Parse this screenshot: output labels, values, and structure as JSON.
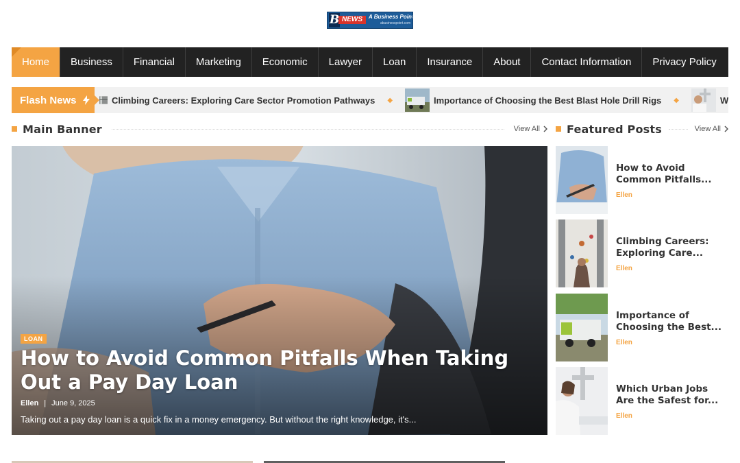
{
  "logo": {
    "letter": "B",
    "badge": "NEWS",
    "tagline": "A Business Point",
    "url": "abusinesspoint.com"
  },
  "nav": {
    "items": [
      {
        "label": "Home",
        "active": true
      },
      {
        "label": "Business"
      },
      {
        "label": "Financial"
      },
      {
        "label": "Marketing"
      },
      {
        "label": "Economic"
      },
      {
        "label": "Lawyer"
      },
      {
        "label": "Loan"
      },
      {
        "label": "Insurance"
      },
      {
        "label": "About"
      },
      {
        "label": "Contact Information"
      },
      {
        "label": "Privacy Policy"
      }
    ]
  },
  "flash": {
    "label": "Flash News",
    "icon": "lightning-icon",
    "items": [
      {
        "title": "Climbing Careers: Exploring Care Sector Promotion Pathways"
      },
      {
        "title": "Importance of Choosing the Best Blast Hole Drill Rigs"
      },
      {
        "title": "Which U"
      }
    ]
  },
  "main_banner": {
    "heading": "Main Banner",
    "view_all": "View All",
    "post": {
      "category": "LOAN",
      "title": "How to Avoid Common Pitfalls When Taking Out a Pay Day Loan",
      "author": "Ellen",
      "separator": "|",
      "date": "June 9, 2025",
      "excerpt": "Taking out a pay day loan is a quick fix in a money emergency. But without the right knowledge, it's..."
    }
  },
  "featured": {
    "heading": "Featured Posts",
    "view_all": "View All",
    "posts": [
      {
        "title": "How to Avoid Common Pitfalls...",
        "author": "Ellen"
      },
      {
        "title": "Climbing Careers: Exploring Care...",
        "author": "Ellen"
      },
      {
        "title": "Importance of Choosing the Best...",
        "author": "Ellen"
      },
      {
        "title": "Which Urban Jobs Are the Safest for...",
        "author": "Ellen"
      }
    ]
  },
  "colors": {
    "accent": "#f4a443",
    "nav_bg": "#222222",
    "flash_bg": "#f1f1f1"
  }
}
